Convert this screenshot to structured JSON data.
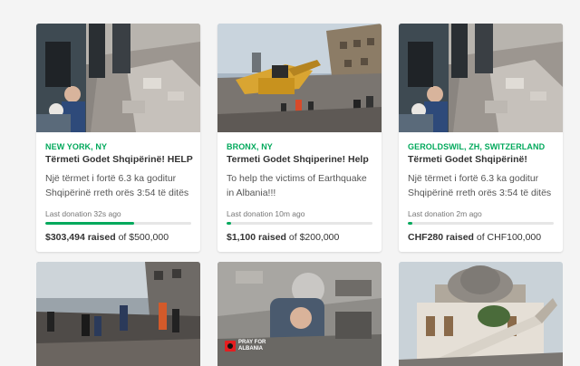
{
  "cards": [
    {
      "location": "NEW YORK, NY",
      "title": "Tërmeti Godet Shqipërinë! HELP",
      "description": "Një tërmet i fortë 6.3 ka goditur Shqipërinë rreth orës 3:54 të ditës ...",
      "last_donation": "Last donation 32s ago",
      "raised": "$303,494 raised",
      "goal": "of $500,000",
      "progress": 0.61
    },
    {
      "location": "BRONX, NY",
      "title": "Termeti Godet Shqiperine! Help",
      "description": "To help the victims of Earthquake in Albania!!!",
      "last_donation": "Last donation 10m ago",
      "raised": "$1,100 raised",
      "goal": "of $200,000",
      "progress": 0.03
    },
    {
      "location": "GEROLDSWIL, ZH, SWITZERLAND",
      "title": "Tërmeti Godet Shqipërinë!",
      "description": "Një tërmet i fortë 6.3 ka goditur Shqipërinë rreth orës 3:54 të ditës ...",
      "last_donation": "Last donation 2m ago",
      "raised": "CHF280 raised",
      "goal": "of CHF100,000",
      "progress": 0.03
    }
  ],
  "badge_text": [
    "PRAY FOR",
    "ALBANIA"
  ],
  "colors": {
    "accent": "#02a95c",
    "bar_track": "#e6e6e6"
  }
}
